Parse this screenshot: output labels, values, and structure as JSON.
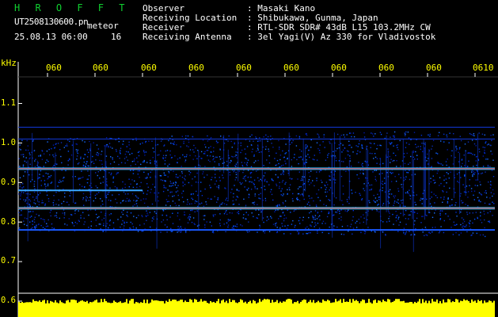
{
  "header": {
    "brand": "H R O F F T",
    "filename": "UT2508130600.pn",
    "tag": "meteor",
    "datetime": "25.08.13 06:00",
    "duration": "16",
    "meta": [
      {
        "key": "Observer",
        "value": ": Masaki Kano"
      },
      {
        "key": "Receiving Location",
        "value": ": Shibukawa, Gunma, Japan"
      },
      {
        "key": "Receiver",
        "value": ": RTL-SDR SDR# 43dB L15 103.2MHz CW"
      },
      {
        "key": "Receiving Antenna",
        "value": ": 3el Yagi(V) Az 330 for Vladivostok"
      }
    ]
  },
  "axis": {
    "unit": "kHz",
    "y_ticks": [
      "1.1",
      "1.0",
      "0.9",
      "0.8",
      "0.7",
      "0.6"
    ],
    "x_ticks": [
      "060",
      "060",
      "060",
      "060",
      "060",
      "060",
      "060",
      "060",
      "060",
      "0610"
    ]
  },
  "colors": {
    "axis_text": "#ffff00",
    "brand": "#10d030",
    "background": "#000000",
    "echo_strength": "#ffff00"
  }
}
